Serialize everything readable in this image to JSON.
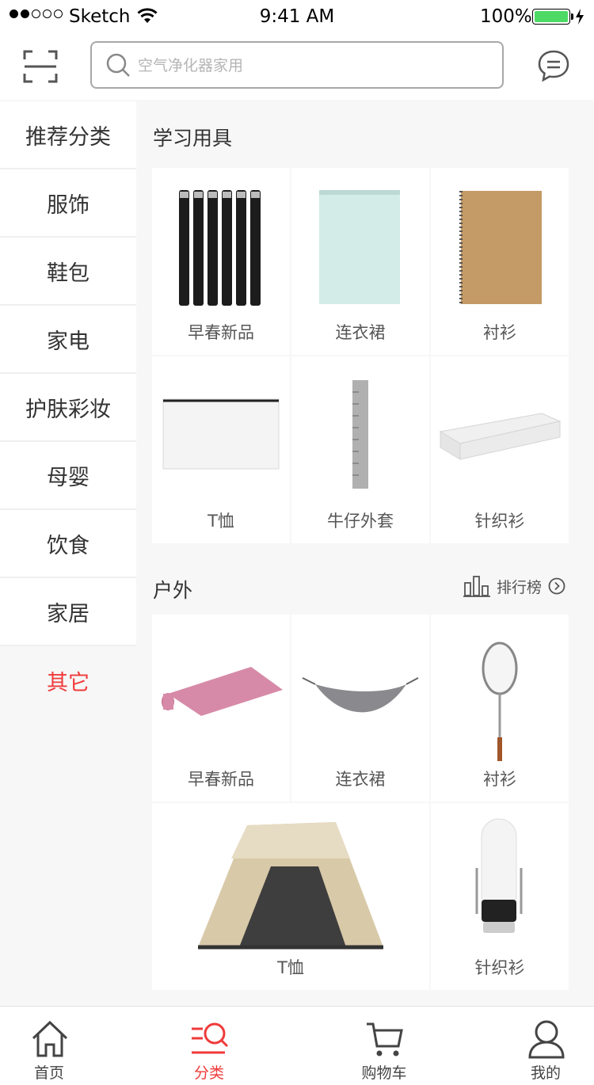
{
  "status_bar": {
    "carrier": "Sketch",
    "time": "9:41 AM",
    "battery_percent": "100%",
    "battery_level": 1.0,
    "signal_bars_filled": 2,
    "signal_bars_total": 5
  },
  "search": {
    "placeholder": "空气净化器家用"
  },
  "icons": {
    "scan": "scan-icon",
    "search": "search-icon",
    "message": "message-icon"
  },
  "sidebar": {
    "items": [
      {
        "label": "推荐分类"
      },
      {
        "label": "服饰"
      },
      {
        "label": "鞋包"
      },
      {
        "label": "家电"
      },
      {
        "label": "护肤彩妆"
      },
      {
        "label": "母婴"
      },
      {
        "label": "饮食"
      },
      {
        "label": "家居"
      },
      {
        "label": "其它"
      }
    ],
    "active_index": 8
  },
  "sections": [
    {
      "title": "学习用具",
      "items": [
        {
          "label": "早春新品",
          "image": "ink-cartridges"
        },
        {
          "label": "连衣裙",
          "image": "notepad"
        },
        {
          "label": "衬衫",
          "image": "spiral-notebook"
        },
        {
          "label": "T恤",
          "image": "zipper-pouch"
        },
        {
          "label": "牛仔外套",
          "image": "ruler"
        },
        {
          "label": "针织衫",
          "image": "pencil-case"
        }
      ]
    },
    {
      "title": "户外",
      "rank_label": "排行榜",
      "items": [
        {
          "label": "早春新品",
          "image": "yoga-mat"
        },
        {
          "label": "连衣裙",
          "image": "hammock"
        },
        {
          "label": "衬衫",
          "image": "badminton-racket"
        },
        {
          "label": "T恤",
          "image": "tent"
        },
        {
          "label": "针织衫",
          "image": "lantern"
        }
      ]
    }
  ],
  "tab_bar": {
    "tabs": [
      {
        "label": "首页",
        "icon": "home-icon"
      },
      {
        "label": "分类",
        "icon": "category-icon"
      },
      {
        "label": "购物车",
        "icon": "cart-icon"
      },
      {
        "label": "我的",
        "icon": "profile-icon"
      }
    ],
    "active_index": 1
  },
  "colors": {
    "accent": "#f03a3a",
    "battery": "#4cd964"
  }
}
